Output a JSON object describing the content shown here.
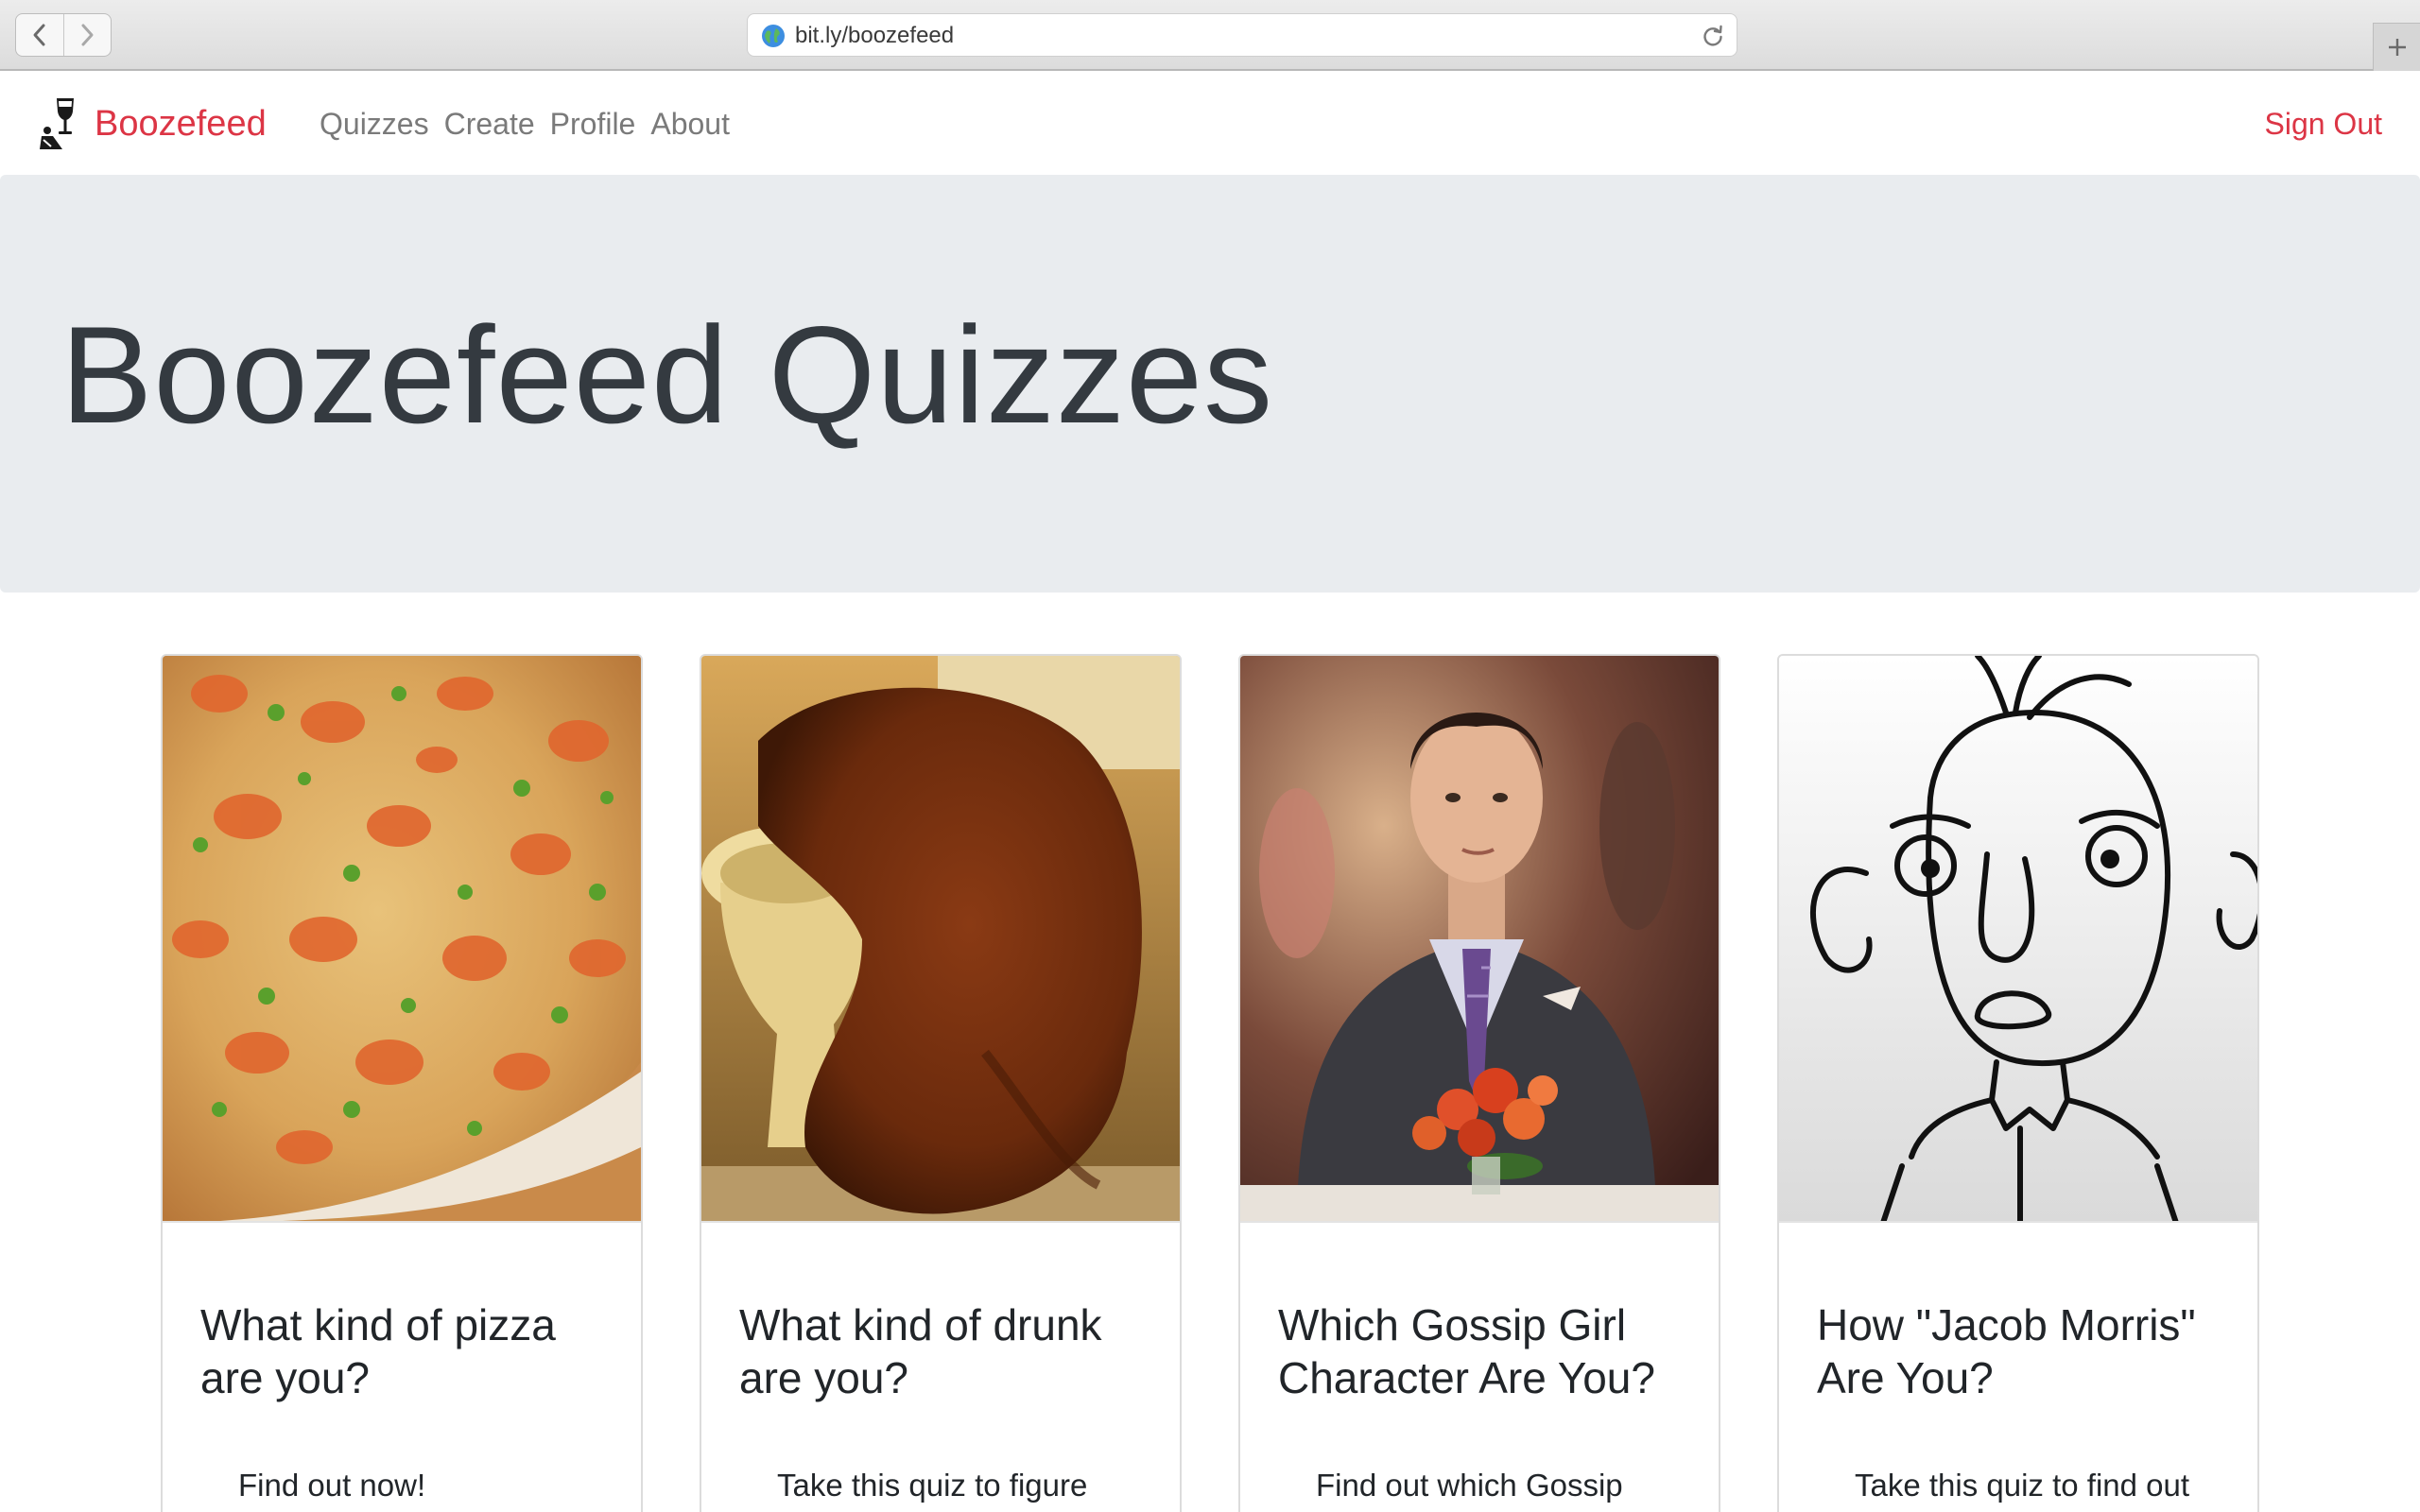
{
  "browser": {
    "url": "bit.ly/boozefeed",
    "icons": {
      "back": "chevron-left-icon",
      "forward": "chevron-right-icon",
      "site": "globe-icon",
      "reload": "reload-icon",
      "new_tab": "plus-icon"
    }
  },
  "navbar": {
    "brand": "Boozefeed",
    "brand_icon": "wine-glass-logo-icon",
    "links": [
      "Quizzes",
      "Create",
      "Profile",
      "About"
    ],
    "sign_out": "Sign Out",
    "accent_color": "#dc3545",
    "link_color": "#7a7a7a"
  },
  "jumbotron": {
    "title": "Boozefeed Quizzes",
    "background": "#e9ecef"
  },
  "cards": [
    {
      "image": "pizza-image",
      "title": "What kind of pizza are you?",
      "text": "Find out now!"
    },
    {
      "image": "drunk-bear-image",
      "title": "What kind of drunk are you?",
      "text": "Take this quiz to figure"
    },
    {
      "image": "gossip-girl-image",
      "title": "Which Gossip Girl Character Are You?",
      "text": "Find out which Gossip"
    },
    {
      "image": "cartoon-face-image",
      "title": "How \"Jacob Morris\" Are You?",
      "text": "Take this quiz to find out"
    }
  ]
}
